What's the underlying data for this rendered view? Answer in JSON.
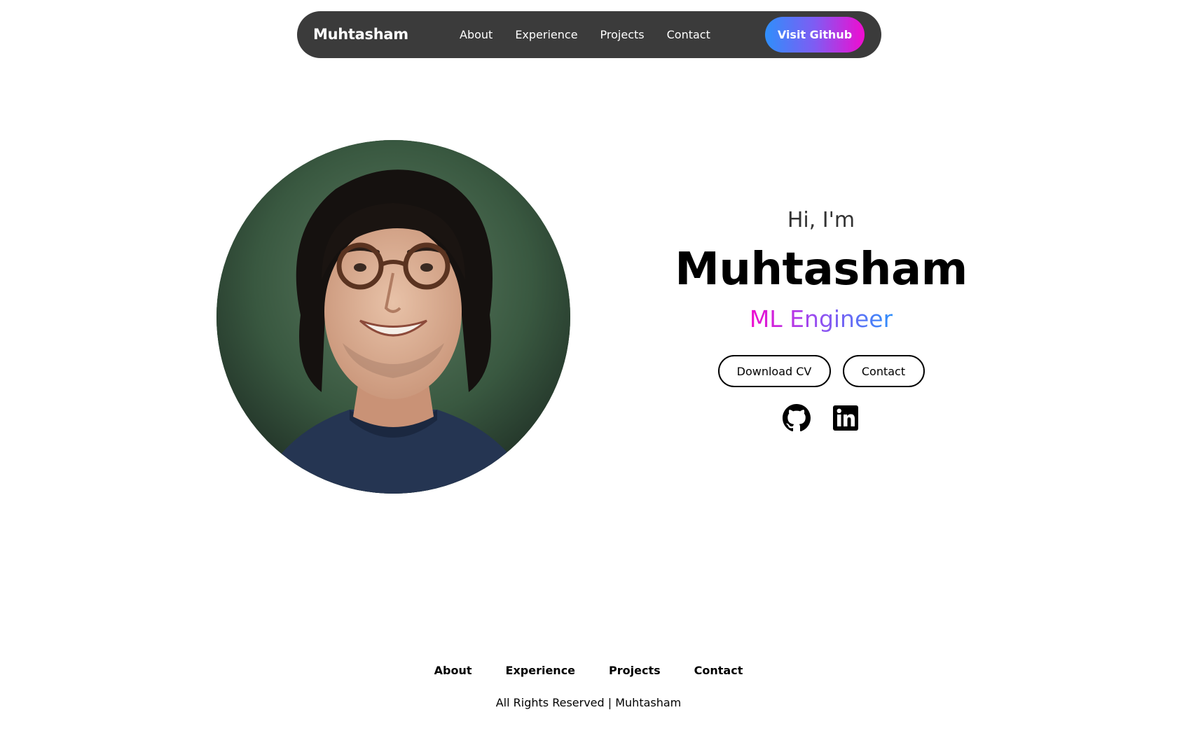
{
  "navbar": {
    "brand": "Muhtasham",
    "links": [
      "About",
      "Experience",
      "Projects",
      "Contact"
    ],
    "cta_label": "Visit Github"
  },
  "hero": {
    "greeting": "Hi, I'm",
    "name": "Muhtasham",
    "role": "ML Engineer",
    "download_cv_label": "Download CV",
    "contact_label": "Contact",
    "socials": [
      "github-icon",
      "linkedin-icon"
    ]
  },
  "footer": {
    "links": [
      "About",
      "Experience",
      "Projects",
      "Contact"
    ],
    "copyright": "All Rights Reserved | Muhtasham"
  },
  "colors": {
    "navbar_bg": "#3b3b3b",
    "gradient_blue": "#2f8ffb",
    "gradient_pink": "#f00ccf"
  }
}
